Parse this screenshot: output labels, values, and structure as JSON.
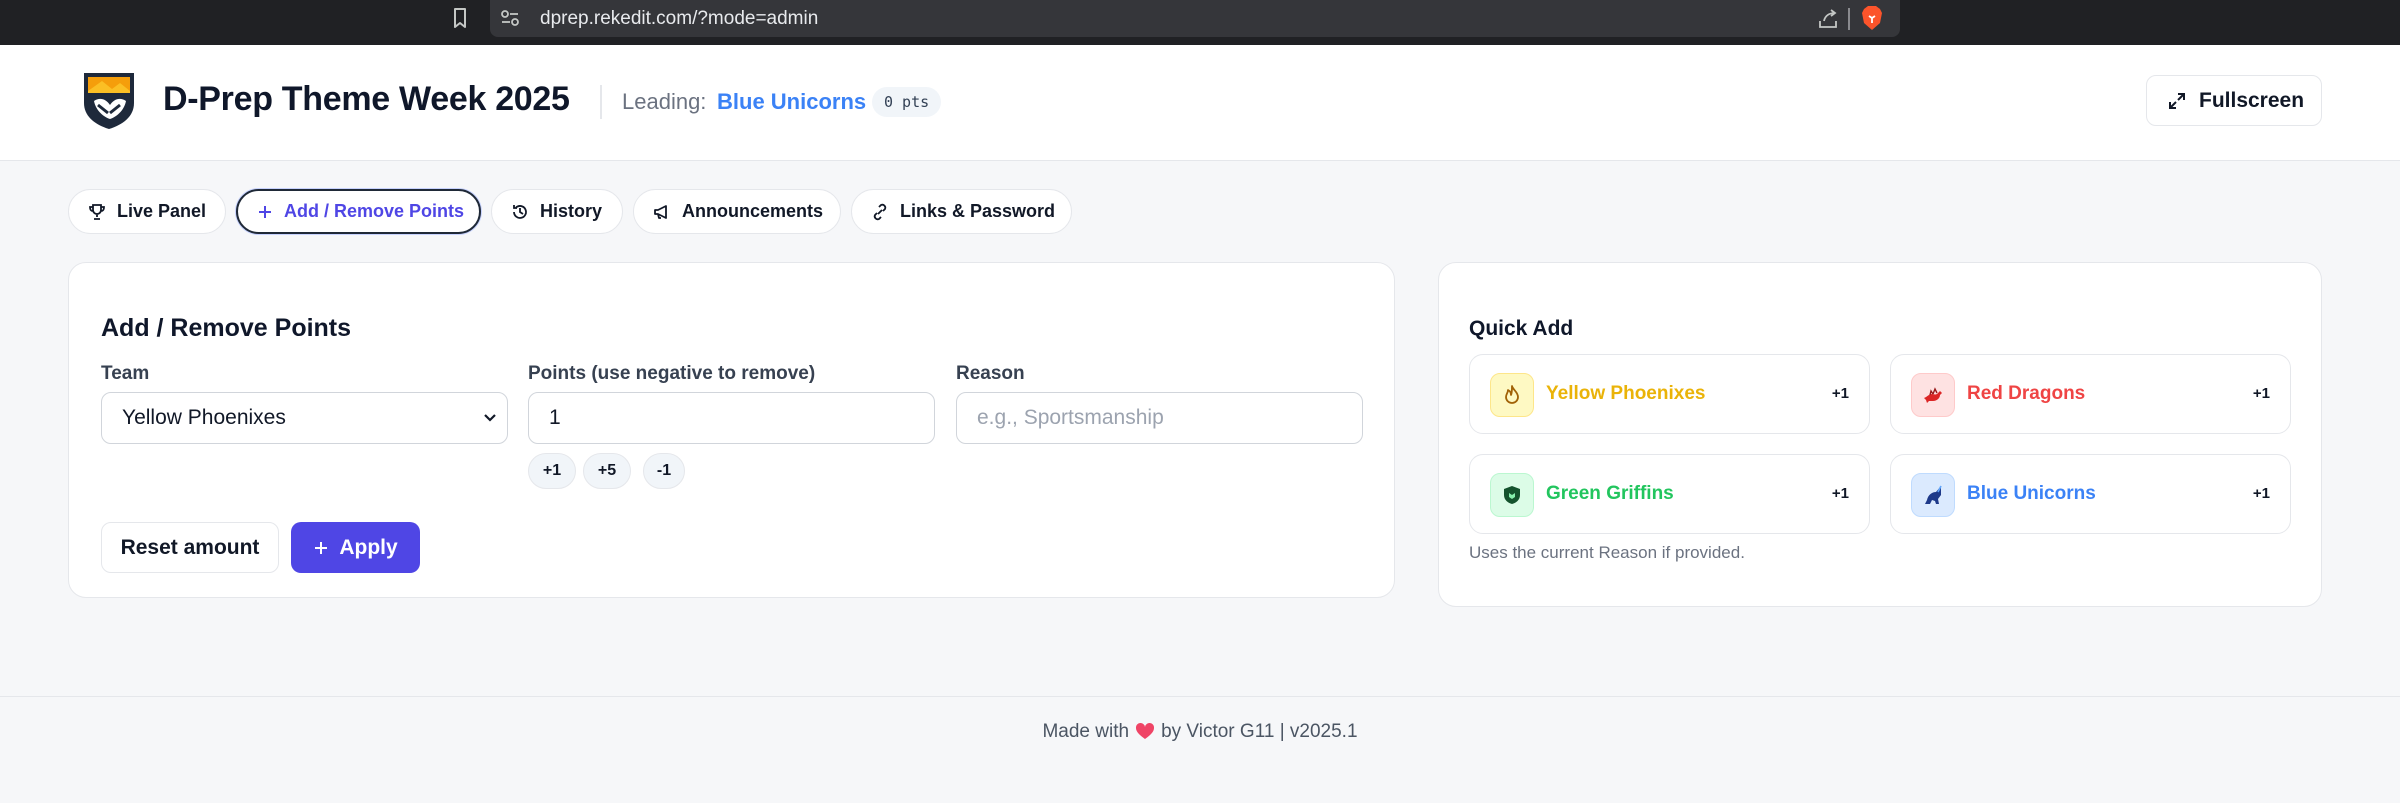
{
  "browser": {
    "url": "dprep.rekedit.com/?mode=admin"
  },
  "header": {
    "title": "D-Prep Theme Week 2025",
    "leading_label": "Leading:",
    "leading_team": "Blue Unicorns",
    "leading_points": "0 pts",
    "fullscreen_label": "Fullscreen"
  },
  "tabs": [
    {
      "label": "Live Panel",
      "icon": "trophy-icon",
      "active": false
    },
    {
      "label": "Add / Remove Points",
      "icon": "plus-icon",
      "active": true
    },
    {
      "label": "History",
      "icon": "history-icon",
      "active": false
    },
    {
      "label": "Announcements",
      "icon": "megaphone-icon",
      "active": false
    },
    {
      "label": "Links & Password",
      "icon": "link-icon",
      "active": false
    }
  ],
  "points_form": {
    "title": "Add / Remove Points",
    "team_label": "Team",
    "team_value": "Yellow Phoenixes",
    "points_label": "Points (use negative to remove)",
    "points_value": "1",
    "reason_label": "Reason",
    "reason_placeholder": "e.g., Sportsmanship",
    "chips": [
      "+1",
      "+5",
      "-1"
    ],
    "reset_label": "Reset amount",
    "apply_label": "Apply"
  },
  "quick_add": {
    "title": "Quick Add",
    "teams": [
      {
        "name": "Yellow Phoenixes",
        "plus": "+1",
        "color": "#eab308",
        "icon": "flame-icon"
      },
      {
        "name": "Red Dragons",
        "plus": "+1",
        "color": "#ef4444",
        "icon": "dragon-icon"
      },
      {
        "name": "Green Griffins",
        "plus": "+1",
        "color": "#22c55e",
        "icon": "shield-icon"
      },
      {
        "name": "Blue Unicorns",
        "plus": "+1",
        "color": "#3b82f6",
        "icon": "unicorn-icon"
      }
    ],
    "note": "Uses the current Reason if provided."
  },
  "footer": {
    "made_with": "Made with",
    "by": "by Victor G11 | v2025.1"
  },
  "colors": {
    "accent": "#4f46e5",
    "leading_team": "#3b82f6"
  }
}
